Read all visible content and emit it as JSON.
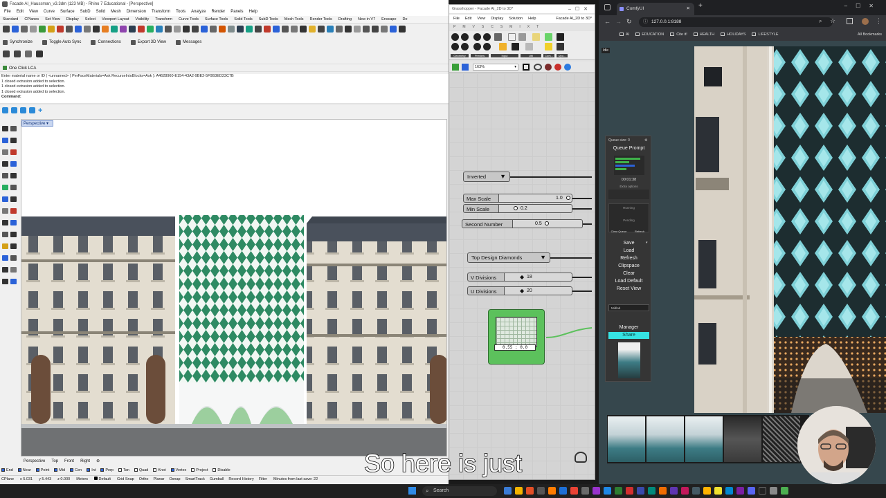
{
  "rhino": {
    "title": "Facade AI_Haussman_v3.3dm (123 MB) - Rhino 7 Educational - [Perspective]",
    "menu": [
      "File",
      "Edit",
      "View",
      "Curve",
      "Surface",
      "SubD",
      "Solid",
      "Mesh",
      "Dimension",
      "Transform",
      "Tools",
      "Analyze",
      "Render",
      "Panels",
      "Help"
    ],
    "tabs": [
      "Standard",
      "CPlanes",
      "Set View",
      "Display",
      "Select",
      "Viewport Layout",
      "Visibility",
      "Transform",
      "Curve Tools",
      "Surface Tools",
      "Solid Tools",
      "SubD Tools",
      "Mesh Tools",
      "Render Tools",
      "Drafting",
      "New in V7",
      "Enscape",
      "De"
    ],
    "sync": [
      "Synchronize",
      "Toggle Auto Sync",
      "Connections",
      "Export 3D View",
      "Messages"
    ],
    "lca_label": "One Click LCA",
    "command_history": [
      "Enter material name or ID ( <unnamed> ) PerFaceMaterials=Ask RecurseIntoBlocks=Ask ): A4628960-E154-43A2-9BE2-5F0B3ED23C7B",
      "1 closed extrusion added to selection.",
      "1 closed extrusion added to selection.",
      "1 closed extrusion added to selection."
    ],
    "command_prompt": "Command:",
    "viewport_label": "Perspective",
    "viewport_tabs": [
      "Perspective",
      "Top",
      "Front",
      "Right",
      "⊕"
    ],
    "osnaps": [
      "End",
      "Near",
      "Point",
      "Mid",
      "Cen",
      "Int",
      "Perp",
      "Tan",
      "Quad",
      "Knot",
      "Vertex",
      "Project",
      "Disable"
    ],
    "status": {
      "cplane": "CPlane",
      "x": "x 5.031",
      "y": "y 5.443",
      "z": "z 0.000",
      "units": "Meters",
      "layer": "Default",
      "toggles": [
        "Grid Snap",
        "Ortho",
        "Planar",
        "Osnap",
        "SmartTrack",
        "Gumball",
        "Record History",
        "Filter"
      ],
      "save_msg": "Minutes from last save: 22"
    }
  },
  "grasshopper": {
    "title": "Grasshopper - Facade AI_2D to 3D*",
    "menu": [
      "File",
      "Edit",
      "View",
      "Display",
      "Solution",
      "Help"
    ],
    "doc_name": "Facade AI_2D to 3D*",
    "tabs": [
      "P",
      "M",
      "V",
      "S",
      "C",
      "S",
      "M",
      "I",
      "X",
      "T"
    ],
    "ribbon_groups": [
      "Geometry",
      "Preview",
      "Input",
      "Util",
      "Com...",
      "Upo..."
    ],
    "zoom": "163%",
    "inverted_label": "Inverted",
    "max_scale": {
      "name": "Max Scale",
      "value": "1.0"
    },
    "min_scale": {
      "name": "Min Scale",
      "value": "0.2"
    },
    "second_number": {
      "name": "Second Number",
      "value": "0.5"
    },
    "top_design_label": "Top Design Diamonds",
    "v_divisions": {
      "name": "V Divisions",
      "value": "18"
    },
    "u_divisions": {
      "name": "U Divisions",
      "value": "20"
    },
    "graph_value": "0.55 : 0.0",
    "accent": "#5cc15c"
  },
  "browser": {
    "tab_title": "ComfyUI",
    "url": "127.0.0.1:8188",
    "bookmarks": [
      "AI",
      "EDUCATION",
      "Cite it!",
      "HEALTH",
      "HOLIDAYS",
      "LIFESTYLE"
    ],
    "all_bookmarks": "All Bookmarks",
    "page_tag": "Idle"
  },
  "comfy": {
    "header": "Queue size: 0",
    "queue_prompt": "Queue Prompt",
    "timer": "00:01:38",
    "extra_options": "Extra options",
    "running": "Running",
    "pending": "Pending",
    "clear_queue": "Clear Queue",
    "refresh_small": "Refresh",
    "save": "Save",
    "load": "Load",
    "refresh": "Refresh",
    "clipspace": "Clipspace",
    "clear": "Clear",
    "load_default": "Load Default",
    "reset_view": "Reset View",
    "model_field": "Midlab",
    "manager": "Manager",
    "share": "Share",
    "share_color": "#36e3e3"
  },
  "taskbar": {
    "search_placeholder": "Search"
  },
  "caption": "So here is just"
}
